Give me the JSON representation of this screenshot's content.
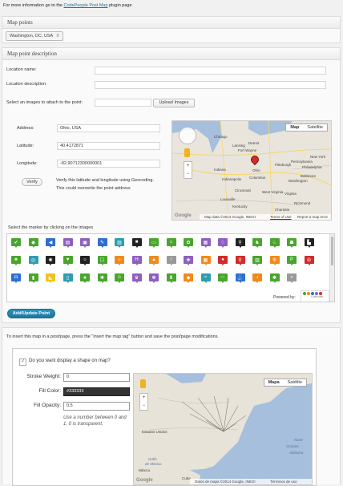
{
  "top_note": {
    "prefix": "For more information go to the ",
    "link": "CodePeople Post Map",
    "suffix": " plugin page"
  },
  "map_points": {
    "title": "Map points",
    "tag_label": "Washington, DC, USA",
    "tag_remove": "X"
  },
  "description": {
    "title": "Map point description",
    "location_name_label": "Location name:",
    "location_name_value": "",
    "location_description_label": "Location description:",
    "location_description_value": "",
    "images_label": "Select an images to attach to the point:",
    "images_button": "Upload Images",
    "address_label": "Address:",
    "address_value": "Ohio, USA",
    "latitude_label": "Latitude:",
    "latitude_value": "40.4172871",
    "longitude_label": "Longitude:",
    "longitude_value": "-82.90712300000001",
    "verify_button": "Verify",
    "verify_note": "Verify this latitude and longitude using Geocoding. This could overwrite the point address",
    "map1": {
      "type_map": "Map",
      "type_satellite": "Satellite",
      "attribution": "Map data ©2013 Google, INEGI",
      "terms": "Terms of Use",
      "report": "Report a map error",
      "logo": "Google",
      "cities": [
        "Chicago",
        "Fort Wayne",
        "Indiana",
        "Ohio",
        "Columbus",
        "Cincinnati",
        "Louisville",
        "Kentucky",
        "West Virginia",
        "Pittsburgh",
        "Philadelphia",
        "Pennsylvania",
        "Baltimore",
        "Washington",
        "Virginia",
        "Richmond",
        "Detroit",
        "Lansing",
        "Indianapolis",
        "New York",
        "Charlotte"
      ],
      "zoom_in": "+",
      "zoom_out": "−"
    },
    "markers_label": "Select the marker by clicking on the images",
    "powered_by": "Powered by:",
    "powered_brand": "Collection",
    "add_update_button": "Add/Update Point"
  },
  "insert_note": "To insert this map in a post/page, press the \"insert the map tag\" button and save the post/page modifications.",
  "shape": {
    "checkbox_checked": "✓",
    "question": "Do you want display a shape on map?",
    "stroke_weight_label": "Stroke Weight:",
    "stroke_weight_value": "0",
    "fill_color_label": "Fill Color:",
    "fill_color_value": "#333333",
    "fill_opacity_label": "Fill Opacity:",
    "fill_opacity_value": "0.5",
    "opacity_hint": "Use a number between 0 and 1. 0 is transparent.",
    "map2": {
      "type_map": "Mapa",
      "type_satellite": "Satélite",
      "labels": [
        "Estados Unidos",
        "México",
        "Cuba",
        "Norte",
        "Golfo",
        "de México",
        "Océano",
        "Atlántico"
      ],
      "attribution": "Datos de mapa ©2014 Google, INEGI",
      "terms": "Términos de uso",
      "logo": "Google",
      "zoom_in": "+",
      "zoom_out": "−"
    }
  },
  "colors": {
    "accent": "#21759b",
    "map_water": "#a5bfdd",
    "map_land": "#e8e3d8",
    "marker_green": "#4aa52e",
    "marker_purple": "#8e5fc2",
    "marker_blue": "#2f6fd0"
  },
  "markers": [
    {
      "icon": "twitter-bird",
      "color": "#4aa52e",
      "glyph": "✔"
    },
    {
      "icon": "shield",
      "color": "#4aa52e",
      "glyph": "◆"
    },
    {
      "icon": "speaker",
      "color": "#2f6fd0",
      "glyph": "◀"
    },
    {
      "icon": "document",
      "color": "#8e5fc2",
      "glyph": "▤"
    },
    {
      "icon": "photo",
      "color": "#8e5fc2",
      "glyph": "▣"
    },
    {
      "icon": "pin",
      "color": "#2f6fd0",
      "glyph": "✎"
    },
    {
      "icon": "book",
      "color": "#2f9db0",
      "glyph": "▥"
    },
    {
      "icon": "bus",
      "color": "#222222",
      "glyph": "■"
    },
    {
      "icon": "monitor",
      "color": "#4aa52e",
      "glyph": "▭"
    },
    {
      "icon": "house",
      "color": "#4aa52e",
      "glyph": "⌂"
    },
    {
      "icon": "leaf",
      "color": "#4aa52e",
      "glyph": "✿"
    },
    {
      "icon": "image",
      "color": "#8e5fc2",
      "glyph": "▦"
    },
    {
      "icon": "wine",
      "color": "#8e5fc2",
      "glyph": "♢"
    },
    {
      "icon": "bicycle",
      "color": "#222222",
      "glyph": "⚲"
    },
    {
      "icon": "deer",
      "color": "#4aa52e",
      "glyph": "♞"
    },
    {
      "icon": "horse",
      "color": "#4aa52e",
      "glyph": "♘"
    },
    {
      "icon": "walker",
      "color": "#4aa52e",
      "glyph": "☗"
    },
    {
      "icon": "factory",
      "color": "#222222",
      "glyph": "▙"
    },
    {
      "icon": "tree",
      "color": "#4aa52e",
      "glyph": "♣"
    },
    {
      "icon": "globe",
      "color": "#2f9db0",
      "glyph": "◎"
    },
    {
      "icon": "biohazard",
      "color": "#222222",
      "glyph": "✺"
    },
    {
      "icon": "heart",
      "color": "#4aa52e",
      "glyph": "♥"
    },
    {
      "icon": "sun",
      "color": "#222222",
      "glyph": "☼"
    },
    {
      "icon": "runner",
      "color": "#4aa52e",
      "glyph": "☐"
    },
    {
      "icon": "hiker",
      "color": "#f08a1c",
      "glyph": "✧"
    },
    {
      "icon": "letter-h",
      "color": "#8e5fc2",
      "glyph": "H"
    },
    {
      "icon": "flame",
      "color": "#f08a1c",
      "glyph": "▲"
    },
    {
      "icon": "knife",
      "color": "#999999",
      "glyph": "/"
    },
    {
      "icon": "hospital",
      "color": "#8e5fc2",
      "glyph": "✚"
    },
    {
      "icon": "table",
      "color": "#f08a1c",
      "glyph": "▦"
    },
    {
      "icon": "speech",
      "color": "#d22b2b",
      "glyph": "●"
    },
    {
      "icon": "map-pin",
      "color": "#d22b2b",
      "glyph": "⚲"
    },
    {
      "icon": "library",
      "color": "#4aa52e",
      "glyph": "▥"
    },
    {
      "icon": "fork",
      "color": "#f08a1c",
      "glyph": "ψ"
    },
    {
      "icon": "parking",
      "color": "#4aa52e",
      "glyph": "P"
    },
    {
      "icon": "peace",
      "color": "#d22b2b",
      "glyph": "☮"
    },
    {
      "icon": "camera",
      "color": "#2f6fd0",
      "glyph": "◘"
    },
    {
      "icon": "bottle",
      "color": "#4aa52e",
      "glyph": "▮"
    },
    {
      "icon": "shoe",
      "color": "#f0c41c",
      "glyph": "◣"
    },
    {
      "icon": "clipboard",
      "color": "#2f9db0",
      "glyph": "▯"
    },
    {
      "icon": "star",
      "color": "#4aa52e",
      "glyph": "★"
    },
    {
      "icon": "snowflake",
      "color": "#4aa52e",
      "glyph": "✱"
    },
    {
      "icon": "person",
      "color": "#4aa52e",
      "glyph": "☺"
    },
    {
      "icon": "crown",
      "color": "#8e5fc2",
      "glyph": "♛"
    },
    {
      "icon": "lotus",
      "color": "#8e5fc2",
      "glyph": "✾"
    },
    {
      "icon": "columns",
      "color": "#4aa52e",
      "glyph": "Ⅲ"
    },
    {
      "icon": "fish",
      "color": "#f08a1c",
      "glyph": "◆"
    },
    {
      "icon": "aquarium",
      "color": "#2f9db0",
      "glyph": "≈"
    },
    {
      "icon": "horseshoe",
      "color": "#4aa52e",
      "glyph": "∩"
    },
    {
      "icon": "anchor",
      "color": "#2f6fd0",
      "glyph": "⚓"
    },
    {
      "icon": "bell",
      "color": "#f08a1c",
      "glyph": "♪"
    },
    {
      "icon": "paw",
      "color": "#4aa52e",
      "glyph": "✽"
    },
    {
      "icon": "magnifier",
      "color": "#999999",
      "glyph": "⌕"
    }
  ]
}
